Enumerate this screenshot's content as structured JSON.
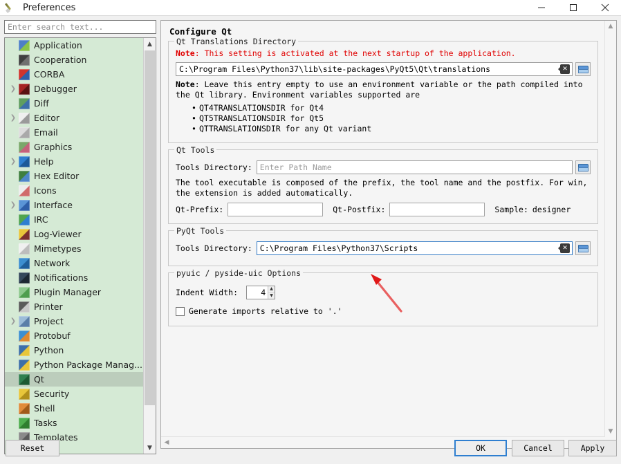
{
  "window": {
    "title": "Preferences",
    "app_icon": "pen-icon",
    "controls": {
      "minimize": "minimize-icon",
      "maximize": "maximize-icon",
      "close": "close-icon"
    }
  },
  "sidebar": {
    "search": {
      "value": "",
      "placeholder": "Enter search text..."
    },
    "items": [
      {
        "label": "Application",
        "icon": "application-icon",
        "expandable": false,
        "selected": false,
        "color1": "#4d7ec8",
        "color2": "#8bc34a"
      },
      {
        "label": "Cooperation",
        "icon": "cooperation-icon",
        "expandable": false,
        "selected": false,
        "color1": "#3f3f3f",
        "color2": "#707070"
      },
      {
        "label": "CORBA",
        "icon": "corba-icon",
        "expandable": false,
        "selected": false,
        "color1": "#d0342c",
        "color2": "#2f5fa8"
      },
      {
        "label": "Debugger",
        "icon": "debugger-bug-icon",
        "expandable": true,
        "selected": false,
        "color1": "#a52222",
        "color2": "#5a1212"
      },
      {
        "label": "Diff",
        "icon": "diff-icon",
        "expandable": false,
        "selected": false,
        "color1": "#5f9e5f",
        "color2": "#3d6fa8"
      },
      {
        "label": "Editor",
        "icon": "editor-pencil-icon",
        "expandable": true,
        "selected": false,
        "color1": "#efefef",
        "color2": "#9a9a9a"
      },
      {
        "label": "Email",
        "icon": "email-icon",
        "expandable": false,
        "selected": false,
        "color1": "#dcdcdc",
        "color2": "#a9a9a9"
      },
      {
        "label": "Graphics",
        "icon": "graphics-icon",
        "expandable": false,
        "selected": false,
        "color1": "#7aa86a",
        "color2": "#c4627a"
      },
      {
        "label": "Help",
        "icon": "help-icon",
        "expandable": true,
        "selected": false,
        "color1": "#2f7fd0",
        "color2": "#1d5a99"
      },
      {
        "label": "Hex Editor",
        "icon": "hex-editor-icon",
        "expandable": false,
        "selected": false,
        "color1": "#3f7f3f",
        "color2": "#4d86c8"
      },
      {
        "label": "Icons",
        "icon": "icons-icon",
        "expandable": false,
        "selected": false,
        "color1": "#ededed",
        "color2": "#d06a6a"
      },
      {
        "label": "Interface",
        "icon": "interface-icon",
        "expandable": true,
        "selected": false,
        "color1": "#5b95d6",
        "color2": "#2f5fa8"
      },
      {
        "label": "IRC",
        "icon": "irc-icon",
        "expandable": false,
        "selected": false,
        "color1": "#4fa44f",
        "color2": "#2f7fd0"
      },
      {
        "label": "Log-Viewer",
        "icon": "log-viewer-icon",
        "expandable": false,
        "selected": false,
        "color1": "#e8c63a",
        "color2": "#7a2f2f"
      },
      {
        "label": "Mimetypes",
        "icon": "mimetypes-icon",
        "expandable": false,
        "selected": false,
        "color1": "#f0f0f0",
        "color2": "#bdbdbd"
      },
      {
        "label": "Network",
        "icon": "network-globe-icon",
        "expandable": false,
        "selected": false,
        "color1": "#3d8fd0",
        "color2": "#1f5f9a"
      },
      {
        "label": "Notifications",
        "icon": "notifications-icon",
        "expandable": false,
        "selected": false,
        "color1": "#35485c",
        "color2": "#1d2833"
      },
      {
        "label": "Plugin Manager",
        "icon": "plugin-manager-icon",
        "expandable": false,
        "selected": false,
        "color1": "#8ec98e",
        "color2": "#4f9e4f"
      },
      {
        "label": "Printer",
        "icon": "printer-icon",
        "expandable": false,
        "selected": false,
        "color1": "#5a5a5a",
        "color2": "#c8c8c8"
      },
      {
        "label": "Project",
        "icon": "project-icon",
        "expandable": true,
        "selected": false,
        "color1": "#9cbcd8",
        "color2": "#5b7fa8"
      },
      {
        "label": "Protobuf",
        "icon": "protobuf-icon",
        "expandable": false,
        "selected": false,
        "color1": "#3d8fd0",
        "color2": "#e08a2f"
      },
      {
        "label": "Python",
        "icon": "python-icon",
        "expandable": false,
        "selected": false,
        "color1": "#3d6fa8",
        "color2": "#e8c63a"
      },
      {
        "label": "Python Package Manag...",
        "icon": "python-icon",
        "expandable": false,
        "selected": false,
        "color1": "#3d6fa8",
        "color2": "#e8c63a"
      },
      {
        "label": "Qt",
        "icon": "qt-icon",
        "expandable": false,
        "selected": true,
        "color1": "#2f7f4f",
        "color2": "#1d5a33"
      },
      {
        "label": "Security",
        "icon": "security-lock-icon",
        "expandable": false,
        "selected": false,
        "color1": "#e8c63a",
        "color2": "#b08f1a"
      },
      {
        "label": "Shell",
        "icon": "shell-icon",
        "expandable": false,
        "selected": false,
        "color1": "#e08a3a",
        "color2": "#a05a1a"
      },
      {
        "label": "Tasks",
        "icon": "tasks-check-icon",
        "expandable": false,
        "selected": false,
        "color1": "#4faf4f",
        "color2": "#2f7f2f"
      },
      {
        "label": "Templates",
        "icon": "templates-icon",
        "expandable": false,
        "selected": false,
        "color1": "#8a8a8a",
        "color2": "#5a5a5a"
      }
    ]
  },
  "main": {
    "page_title": "Configure Qt",
    "translations_group": {
      "title": "Qt Translations Directory",
      "note_label": "Note",
      "note_sep": ": ",
      "note_text": "This setting is activated at the next startup of the application.",
      "path_value": "C:\\Program Files\\Python37\\lib\\site-packages\\PyQt5\\Qt\\translations",
      "path_placeholder": "",
      "note2_label": "Note",
      "note2_text": ": Leave this entry empty to use an environment variable or the path compiled into the Qt library. Environment variables supported are",
      "bullets": [
        "QT4TRANSLATIONSDIR for Qt4",
        "QT5TRANSLATIONSDIR for Qt5",
        "QTTRANSLATIONSDIR for any Qt variant"
      ],
      "clear_icon": "clear-backspace-icon",
      "open_icon": "open-folder-icon"
    },
    "qt_tools_group": {
      "title": "Qt Tools",
      "tools_dir_label": "Tools Directory:",
      "tools_dir_value": "",
      "tools_dir_placeholder": "Enter Path Name",
      "description": "The tool executable is composed of the prefix, the tool name and the postfix. For win, the extension is added automatically.",
      "prefix_label": "Qt-Prefix:",
      "prefix_value": "",
      "postfix_label": "Qt-Postfix:",
      "postfix_value": "",
      "sample_label": "Sample:",
      "sample_value": "designer",
      "open_icon": "open-folder-icon"
    },
    "pyqt_tools_group": {
      "title": "PyQt Tools",
      "tools_dir_label": "Tools Directory:",
      "tools_dir_value": "C:\\Program Files\\Python37\\Scripts",
      "clear_icon": "clear-backspace-icon",
      "open_icon": "open-folder-icon"
    },
    "pyuic_group": {
      "title": "pyuic / pyside-uic Options",
      "indent_label": "Indent Width:",
      "indent_value": "4",
      "checkbox_label": "Generate imports relative to '.'",
      "checkbox_checked": false
    }
  },
  "footer": {
    "reset": "Reset",
    "ok": "OK",
    "cancel": "Cancel",
    "apply": "Apply"
  },
  "annotation": {
    "type": "red-arrow",
    "color": "#e03030",
    "points_to": "pyqt-tools-directory-input"
  }
}
